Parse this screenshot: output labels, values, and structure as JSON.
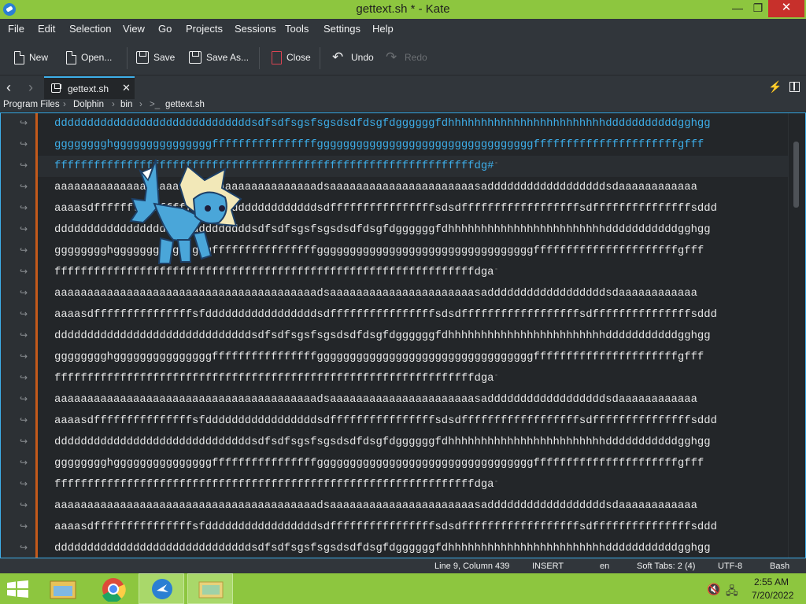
{
  "window": {
    "title": "gettext.sh * - Kate",
    "controls": {
      "minimize": "—",
      "maximize": "❐",
      "close": "✕"
    }
  },
  "menu": [
    "File",
    "Edit",
    "Selection",
    "View",
    "Go",
    "Projects",
    "Sessions",
    "Tools",
    "Settings",
    "Help"
  ],
  "toolbar": {
    "new": "New",
    "open": "Open...",
    "save": "Save",
    "save_as": "Save As...",
    "close": "Close",
    "undo": "Undo",
    "redo": "Redo"
  },
  "tab": {
    "label": "gettext.sh",
    "close": "✕"
  },
  "breadcrumb": [
    "Program Files",
    "Dolphin",
    "bin",
    "gettext.sh"
  ],
  "editor": {
    "wrap_marker": "↪",
    "current_line_end_marker": "˚",
    "lines": [
      "ddddddddddddddddddddddddddddddsdfsdfsgsfsgsdsdfdsgfdggggggfdhhhhhhhhhhhhhhhhhhhhhhhhdddddddddddgghgg",
      "gggggggghgggggggggggggggffffffffffffffffgggggggggggggggggggggggggggggggggffffffffffffffffffffffgfff",
      "ffffffffffffffffffffffffffffffffffffffffffffffffffffffffffffffffdg#",
      "aaaaaaaaaaaaaaaaaaaaaaaaaaaaaaaaaaaaaaaadsaaaaaaaaaaaaaaaaaaaaaasaddddddddddddddddddsdaaaaaaaaaaaa",
      "aaaasdfffffffffffffffsfdddddddddddddddddsdffffffffffffffffsdsdffffffffffffffffffsdfffffffffffffffsddd",
      "ddddddddddddddddddddddddddddddsdfsdfsgsfsgsdsdfdsgfdggggggfdhhhhhhhhhhhhhhhhhhhhhhhhdddddddddddgghgg",
      "gggggggghgggggggggggggggffffffffffffffffgggggggggggggggggggggggggggggggggffffffffffffffffffffffgfff",
      "ffffffffffffffffffffffffffffffffffffffffffffffffffffffffffffffffdga",
      "aaaaaaaaaaaaaaaaaaaaaaaaaaaaaaaaaaaaaaaadsaaaaaaaaaaaaaaaaaaaaaasaddddddddddddddddddsdaaaaaaaaaaaa",
      "aaaasdfffffffffffffffsfdddddddddddddddddsdffffffffffffffffsdsdffffffffffffffffffsdfffffffffffffffsddd",
      "ddddddddddddddddddddddddddddddsdfsdfsgsfsgsdsdfdsgfdggggggfdhhhhhhhhhhhhhhhhhhhhhhhhdddddddddddgghgg",
      "gggggggghgggggggggggggggffffffffffffffffgggggggggggggggggggggggggggggggggffffffffffffffffffffffgfff",
      "ffffffffffffffffffffffffffffffffffffffffffffffffffffffffffffffffdga",
      "aaaaaaaaaaaaaaaaaaaaaaaaaaaaaaaaaaaaaaaadsaaaaaaaaaaaaaaaaaaaaaasaddddddddddddddddddsdaaaaaaaaaaaa",
      "aaaasdfffffffffffffffsfdddddddddddddddddsdffffffffffffffffsdsdffffffffffffffffffsdfffffffffffffffsddd",
      "ddddddddddddddddddddddddddddddsdfsdfsgsfsgsdsdfdsgfdggggggfdhhhhhhhhhhhhhhhhhhhhhhhhdddddddddddgghgg",
      "gggggggghgggggggggggggggffffffffffffffffgggggggggggggggggggggggggggggggggffffffffffffffffffffffgfff",
      "ffffffffffffffffffffffffffffffffffffffffffffffffffffffffffffffffdga",
      "aaaaaaaaaaaaaaaaaaaaaaaaaaaaaaaaaaaaaaaadsaaaaaaaaaaaaaaaaaaaaaasaddddddddddddddddddsdaaaaaaaaaaaa",
      "aaaasdfffffffffffffffsfdddddddddddddddddsdffffffffffffffffsdsdffffffffffffffffffsdfffffffffffffffsddd",
      "ddddddddddddddddddddddddddddddsdfsdfsgsfsgsdsdfdsgfdggggggfdhhhhhhhhhhhhhhhhhhhhhhhhdddddddddddgghgg"
    ]
  },
  "status": {
    "position": "Line 9, Column 439",
    "mode": "INSERT",
    "language": "en",
    "tabs": "Soft Tabs: 2 (4)",
    "encoding": "UTF-8",
    "syntax": "Bash"
  },
  "taskbar": {
    "time": "2:55 AM",
    "date": "7/20/2022"
  },
  "colors": {
    "accent": "#3daee9",
    "title_bar": "#8dc63f",
    "close_button": "#c7302b",
    "fold_bar": "#c45a1b"
  }
}
